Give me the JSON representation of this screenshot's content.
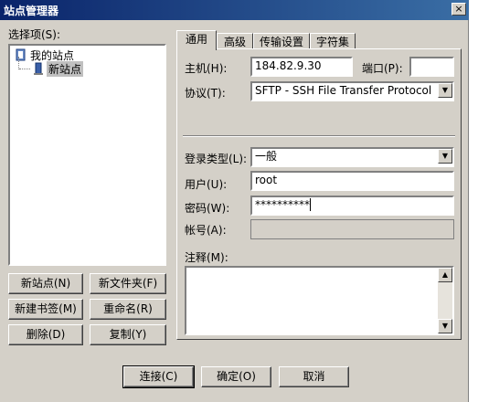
{
  "window": {
    "title": "站点管理器",
    "close_glyph": "×"
  },
  "left": {
    "tree_label": "选择项(S):",
    "tree": [
      {
        "label": "我的站点",
        "icon": "folder-icon",
        "level": 0
      },
      {
        "label": "新站点",
        "icon": "server-icon",
        "level": 1,
        "selected": true
      }
    ],
    "buttons": {
      "new_site": "新站点(N)",
      "new_folder": "新文件夹(F)",
      "new_bookmark": "新建书签(M)",
      "rename": "重命名(R)",
      "delete": "删除(D)",
      "copy": "复制(Y)"
    }
  },
  "tabs": [
    "通用",
    "高级",
    "传输设置",
    "字符集"
  ],
  "general": {
    "host_label": "主机(H):",
    "host_value": "184.82.9.30",
    "port_label": "端口(P):",
    "port_value": "",
    "protocol_label": "协议(T):",
    "protocol_value": "SFTP - SSH File Transfer Protocol",
    "logon_type_label": "登录类型(L):",
    "logon_type_value": "一般",
    "user_label": "用户(U):",
    "user_value": "root",
    "password_label": "密码(W):",
    "password_value": "**********",
    "account_label": "帐号(A):",
    "account_value": "",
    "comments_label": "注释(M):",
    "comments_value": ""
  },
  "footer": {
    "connect": "连接(C)",
    "ok": "确定(O)",
    "cancel": "取消"
  },
  "colors": {
    "title_start": "#0a246a",
    "title_end": "#3a6ea5",
    "selection": "#c0c0c0",
    "face": "#d4d0c8"
  }
}
